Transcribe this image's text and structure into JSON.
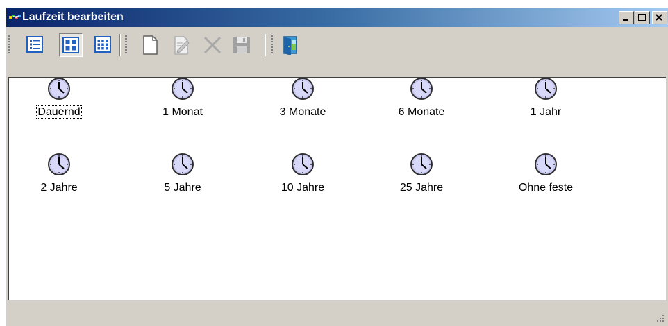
{
  "window": {
    "title": "Laufzeit bearbeiten",
    "icon": "app-icon",
    "controls": [
      {
        "name": "minimize",
        "icon": "minimize-icon"
      },
      {
        "name": "maximize",
        "icon": "maximize-icon"
      },
      {
        "name": "close",
        "icon": "close-icon"
      }
    ]
  },
  "toolbar": {
    "view_buttons": [
      {
        "name": "details-view",
        "icon": "details-view-icon",
        "pressed": false
      },
      {
        "name": "large-icons-view",
        "icon": "large-icons-view-icon",
        "pressed": true
      },
      {
        "name": "small-icons-view",
        "icon": "small-icons-view-icon",
        "pressed": false
      }
    ],
    "action_buttons": [
      {
        "name": "new",
        "icon": "new-document-icon",
        "enabled": true
      },
      {
        "name": "edit",
        "icon": "edit-icon",
        "enabled": false
      },
      {
        "name": "delete",
        "icon": "delete-icon",
        "enabled": false
      },
      {
        "name": "save",
        "icon": "save-icon",
        "enabled": false
      }
    ],
    "exit_button": {
      "name": "exit",
      "icon": "exit-door-icon"
    }
  },
  "items": [
    {
      "label": "Dauernd",
      "icon": "clock-icon",
      "focused": true
    },
    {
      "label": "1 Monat",
      "icon": "clock-icon"
    },
    {
      "label": "3 Monate",
      "icon": "clock-icon"
    },
    {
      "label": "6 Monate",
      "icon": "clock-icon"
    },
    {
      "label": "1 Jahr",
      "icon": "clock-icon"
    },
    {
      "label": "2 Jahre",
      "icon": "clock-icon"
    },
    {
      "label": "5 Jahre",
      "icon": "clock-icon"
    },
    {
      "label": "10 Jahre",
      "icon": "clock-icon"
    },
    {
      "label": "25 Jahre",
      "icon": "clock-icon"
    },
    {
      "label": "Ohne feste",
      "icon": "clock-icon"
    }
  ],
  "colors": {
    "title_start": "#0a246a",
    "title_end": "#a6caf0",
    "face": "#d4d0c8",
    "clock_face": "#c8c8f0"
  }
}
